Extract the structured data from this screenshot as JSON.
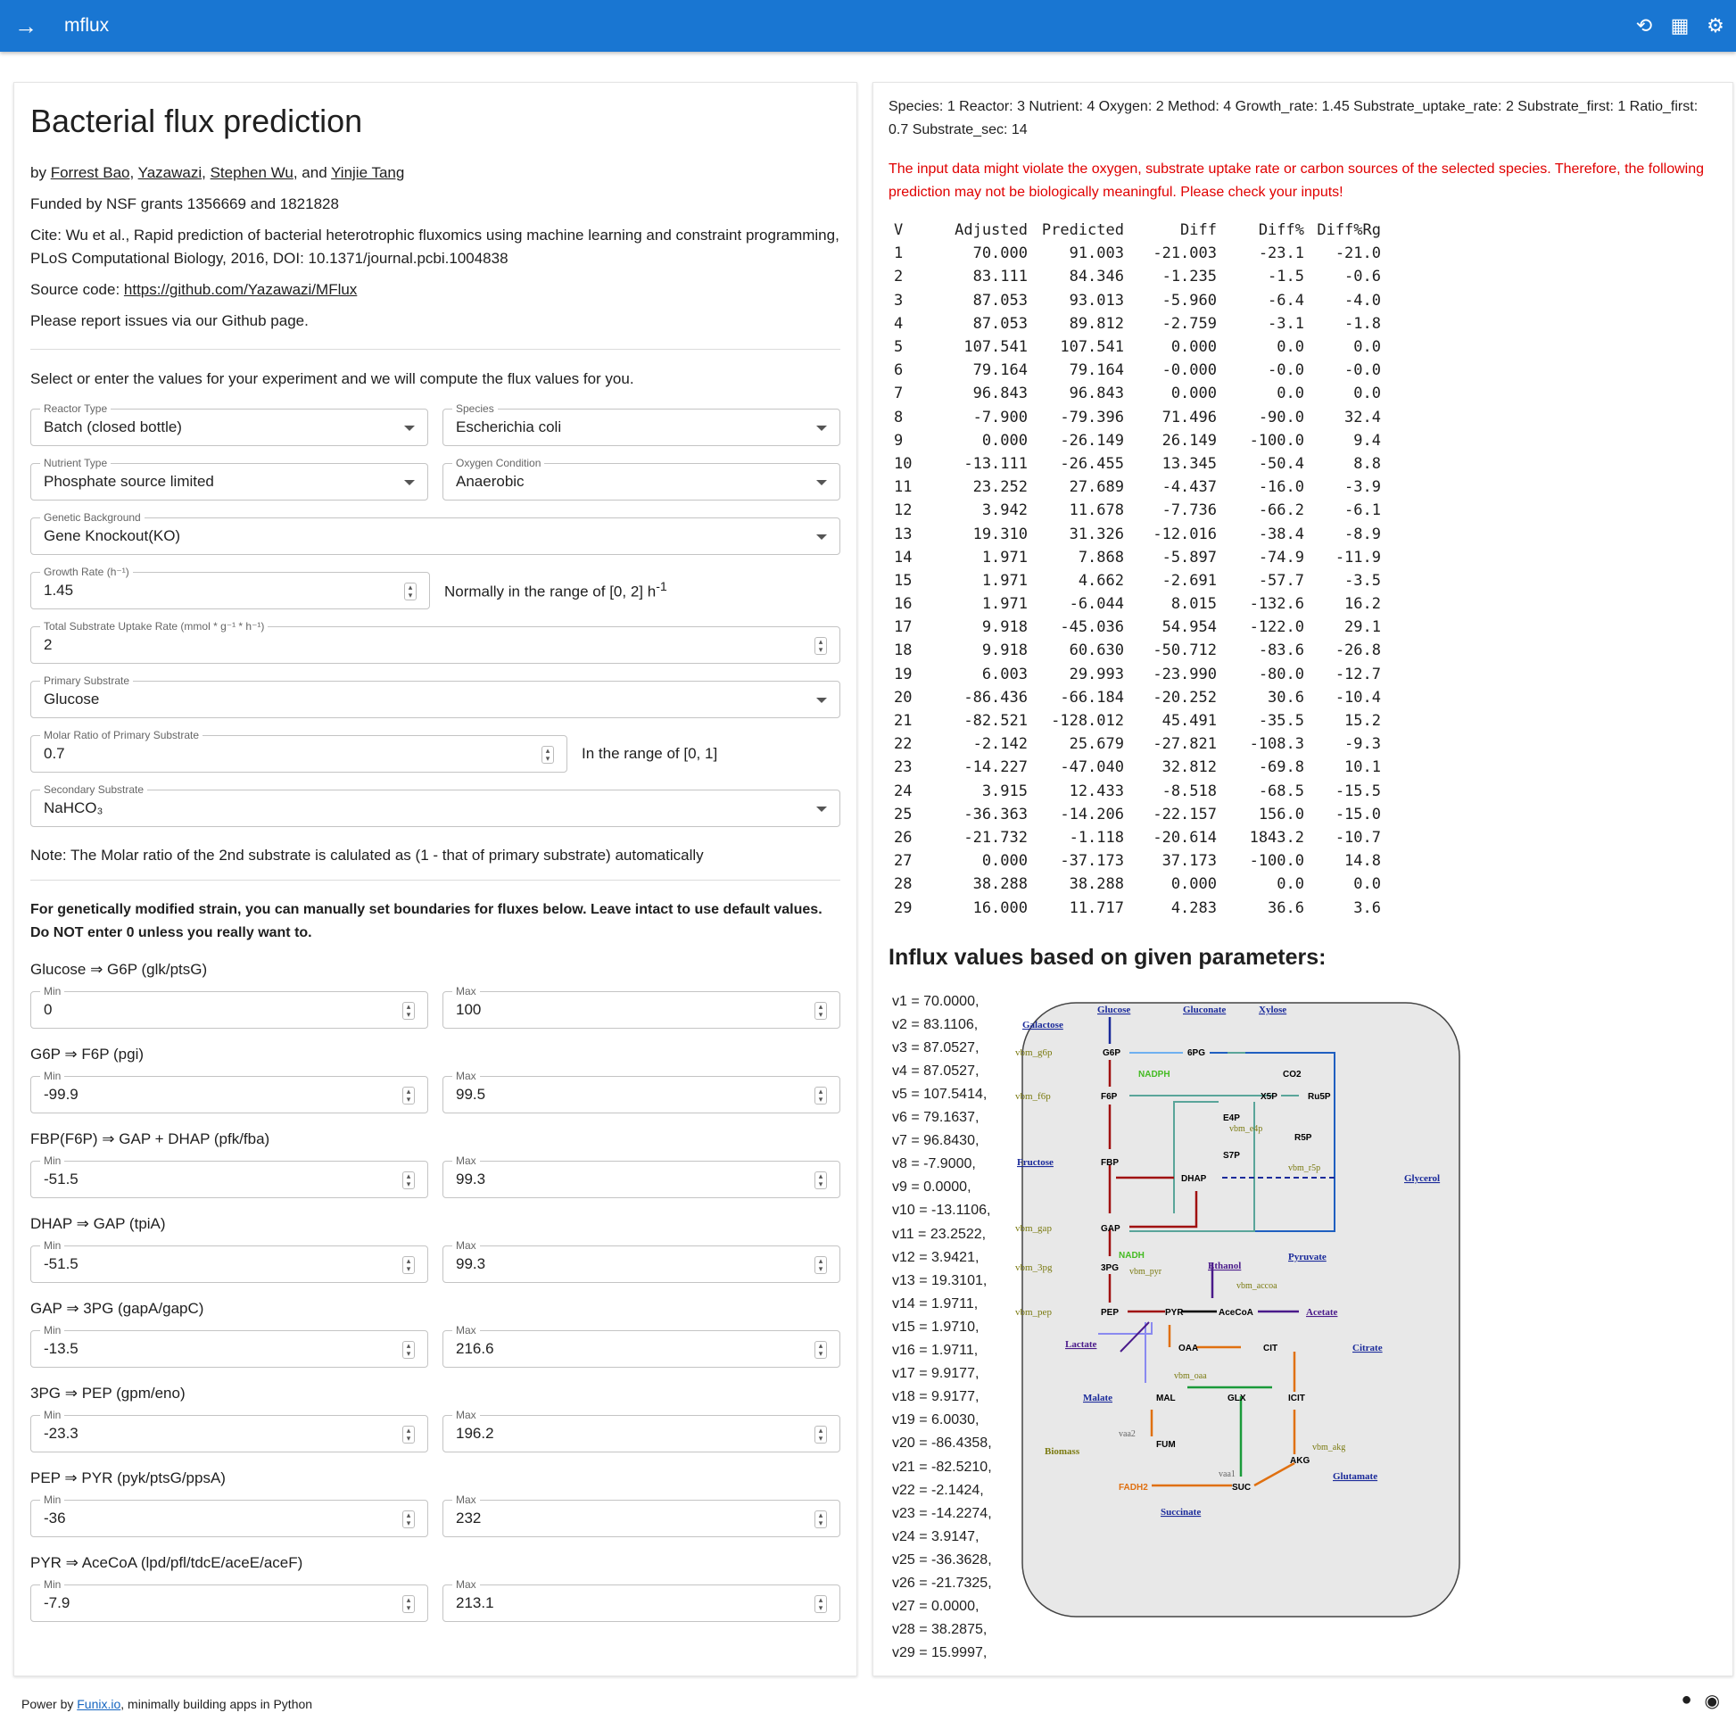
{
  "app": {
    "title": "mflux"
  },
  "header_icons": [
    "arrow-right-icon",
    "history-icon",
    "calendar-icon",
    "gear-icon"
  ],
  "left": {
    "title": "Bacterial flux prediction",
    "by_prefix": "by ",
    "authors": [
      "Forrest Bao",
      "Yazawazi",
      "Stephen Wu",
      "Yinjie Tang"
    ],
    "authors_sep1": ", ",
    "authors_sep2": ", ",
    "authors_sep3": ", and ",
    "funded": "Funded by NSF grants 1356669 and 1821828",
    "cite": "Cite: Wu et al., Rapid prediction of bacterial heterotrophic fluxomics using machine learning and constraint programming, PLoS Computational Biology, 2016, DOI: 10.1371/journal.pcbi.1004838",
    "source_prefix": "Source code: ",
    "source_link": "https://github.com/Yazawazi/MFlux",
    "report": "Please report issues via our Github page.",
    "select_text": "Select or enter the values for your experiment and we will compute the flux values for you.",
    "fields": {
      "reactor": {
        "label": "Reactor Type",
        "value": "Batch (closed bottle)"
      },
      "species": {
        "label": "Species",
        "value": "Escherichia coli"
      },
      "nutrient": {
        "label": "Nutrient Type",
        "value": "Phosphate source limited"
      },
      "oxygen": {
        "label": "Oxygen Condition",
        "value": "Anaerobic"
      },
      "genetic": {
        "label": "Genetic Background",
        "value": "Gene Knockout(KO)"
      },
      "growth": {
        "label": "Growth Rate (h⁻¹)",
        "value": "1.45",
        "note": "Normally in the range of [0, 2] h",
        "note_sup": "-1"
      },
      "uptake": {
        "label": "Total Substrate Uptake Rate (mmol * g⁻¹ * h⁻¹)",
        "value": "2"
      },
      "primary": {
        "label": "Primary Substrate",
        "value": "Glucose"
      },
      "ratio": {
        "label": "Molar Ratio of Primary Substrate",
        "value": "0.7",
        "note": "In the range of [0, 1]"
      },
      "secondary": {
        "label": "Secondary Substrate",
        "value": "NaHCO₃"
      }
    },
    "note2": "Note: The Molar ratio of the 2nd substrate is calulated as (1 - that of primary substrate) automatically",
    "gm_note": "For genetically modified strain, you can manually set boundaries for fluxes below. Leave intact to use default values. Do NOT enter 0 unless you really want to.",
    "min_label": "Min",
    "max_label": "Max",
    "bounds": [
      {
        "name": "Glucose ⇒ G6P (glk/ptsG)",
        "min": "0",
        "max": "100"
      },
      {
        "name": "G6P ⇒ F6P (pgi)",
        "min": "-99.9",
        "max": "99.5"
      },
      {
        "name": "FBP(F6P) ⇒ GAP + DHAP (pfk/fba)",
        "min": "-51.5",
        "max": "99.3"
      },
      {
        "name": "DHAP ⇒ GAP (tpiA)",
        "min": "-51.5",
        "max": "99.3"
      },
      {
        "name": "GAP ⇒ 3PG (gapA/gapC)",
        "min": "-13.5",
        "max": "216.6"
      },
      {
        "name": "3PG ⇒ PEP (gpm/eno)",
        "min": "-23.3",
        "max": "196.2"
      },
      {
        "name": "PEP ⇒ PYR (pyk/ptsG/ppsA)",
        "min": "-36",
        "max": "232"
      },
      {
        "name": "PYR ⇒ AceCoA (lpd/pfl/tdcE/aceE/aceF)",
        "min": "-7.9",
        "max": "213.1"
      }
    ]
  },
  "right": {
    "status": "Species: 1 Reactor: 3 Nutrient: 4 Oxygen: 2 Method: 4 Growth_rate: 1.45 Substrate_uptake_rate: 2 Substrate_first: 1 Ratio_first: 0.7 Substrate_sec: 14",
    "warning": "The input data might violate the oxygen, substrate uptake rate or carbon sources of the selected species. Therefore, the following prediction may not be biologically meaningful. Please check your inputs!",
    "table_headers": [
      "V",
      "Adjusted",
      "Predicted",
      "Diff",
      "Diff%",
      "Diff%Rg"
    ],
    "table_rows": [
      [
        "1",
        "70.000",
        "91.003",
        "-21.003",
        "-23.1",
        "-21.0"
      ],
      [
        "2",
        "83.111",
        "84.346",
        "-1.235",
        "-1.5",
        "-0.6"
      ],
      [
        "3",
        "87.053",
        "93.013",
        "-5.960",
        "-6.4",
        "-4.0"
      ],
      [
        "4",
        "87.053",
        "89.812",
        "-2.759",
        "-3.1",
        "-1.8"
      ],
      [
        "5",
        "107.541",
        "107.541",
        "0.000",
        "0.0",
        "0.0"
      ],
      [
        "6",
        "79.164",
        "79.164",
        "-0.000",
        "-0.0",
        "-0.0"
      ],
      [
        "7",
        "96.843",
        "96.843",
        "0.000",
        "0.0",
        "0.0"
      ],
      [
        "8",
        "-7.900",
        "-79.396",
        "71.496",
        "-90.0",
        "32.4"
      ],
      [
        "9",
        "0.000",
        "-26.149",
        "26.149",
        "-100.0",
        "9.4"
      ],
      [
        "10",
        "-13.111",
        "-26.455",
        "13.345",
        "-50.4",
        "8.8"
      ],
      [
        "11",
        "23.252",
        "27.689",
        "-4.437",
        "-16.0",
        "-3.9"
      ],
      [
        "12",
        "3.942",
        "11.678",
        "-7.736",
        "-66.2",
        "-6.1"
      ],
      [
        "13",
        "19.310",
        "31.326",
        "-12.016",
        "-38.4",
        "-8.9"
      ],
      [
        "14",
        "1.971",
        "7.868",
        "-5.897",
        "-74.9",
        "-11.9"
      ],
      [
        "15",
        "1.971",
        "4.662",
        "-2.691",
        "-57.7",
        "-3.5"
      ],
      [
        "16",
        "1.971",
        "-6.044",
        "8.015",
        "-132.6",
        "16.2"
      ],
      [
        "17",
        "9.918",
        "-45.036",
        "54.954",
        "-122.0",
        "29.1"
      ],
      [
        "18",
        "9.918",
        "60.630",
        "-50.712",
        "-83.6",
        "-26.8"
      ],
      [
        "19",
        "6.003",
        "29.993",
        "-23.990",
        "-80.0",
        "-12.7"
      ],
      [
        "20",
        "-86.436",
        "-66.184",
        "-20.252",
        "30.6",
        "-10.4"
      ],
      [
        "21",
        "-82.521",
        "-128.012",
        "45.491",
        "-35.5",
        "15.2"
      ],
      [
        "22",
        "-2.142",
        "25.679",
        "-27.821",
        "-108.3",
        "-9.3"
      ],
      [
        "23",
        "-14.227",
        "-47.040",
        "32.812",
        "-69.8",
        "10.1"
      ],
      [
        "24",
        "3.915",
        "12.433",
        "-8.518",
        "-68.5",
        "-15.5"
      ],
      [
        "25",
        "-36.363",
        "-14.206",
        "-22.157",
        "156.0",
        "-15.0"
      ],
      [
        "26",
        "-21.732",
        "-1.118",
        "-20.614",
        "1843.2",
        "-10.7"
      ],
      [
        "27",
        "0.000",
        "-37.173",
        "37.173",
        "-100.0",
        "14.8"
      ],
      [
        "28",
        "38.288",
        "38.288",
        "0.000",
        "0.0",
        "0.0"
      ],
      [
        "29",
        "16.000",
        "11.717",
        "4.283",
        "36.6",
        "3.6"
      ]
    ],
    "influx_title": "Influx values based on given parameters:",
    "influx_values": [
      "v1 = 70.0000,",
      "v2 = 83.1106,",
      "v3 = 87.0527,",
      "v4 = 87.0527,",
      "v5 = 107.5414,",
      "v6 = 79.1637,",
      "v7 = 96.8430,",
      "v8 = -7.9000,",
      "v9 = 0.0000,",
      "v10 = -13.1106,",
      "v11 = 23.2522,",
      "v12 = 3.9421,",
      "v13 = 19.3101,",
      "v14 = 1.9711,",
      "v15 = 1.9710,",
      "v16 = 1.9711,",
      "v17 = 9.9177,",
      "v18 = 9.9177,",
      "v19 = 6.0030,",
      "v20 = -86.4358,",
      "v21 = -82.5210,",
      "v22 = -2.1424,",
      "v23 = -14.2274,",
      "v24 = 3.9147,",
      "v25 = -36.3628,",
      "v26 = -21.7325,",
      "v27 = 0.0000,",
      "v28 = 38.2875,",
      "v29 = 15.9997,"
    ],
    "diagram": {
      "metabolites": [
        "Glucose",
        "Gluconate",
        "Xylose",
        "Galactose",
        "G6P",
        "6PG",
        "vbm_g6p",
        "NADPH",
        "CO2",
        "X5P",
        "Ru5P",
        "F6P",
        "vbm_f6p",
        "E4P",
        "vbm_e4p",
        "R5P",
        "S7P",
        "vbm_r5p",
        "Fructose",
        "FBP",
        "DHAP",
        "Glycerol",
        "GAP",
        "vbm_gap",
        "3PG",
        "vbm_3pg",
        "NADH",
        "vbm_pyr",
        "Ethanol",
        "Pyruvate",
        "vbm_accoa",
        "PEP",
        "vbm_pep",
        "PYR",
        "AceCoA",
        "Acetate",
        "Lactate",
        "OAA",
        "CIT",
        "Citrate",
        "vbm_oaa",
        "Malate",
        "MAL",
        "GLX",
        "ICIT",
        "vaa2",
        "FUM",
        "Biomass",
        "AKG",
        "vbm_akg",
        "Glutamate",
        "vaa1",
        "SUC",
        "FADH2",
        "Succinate"
      ],
      "colors": {
        "glycolysis": "#a01010",
        "ppp": "#5aa59a",
        "tca": "#e07010",
        "dashed": "#1a2a9a",
        "nadph": "#44bb22",
        "green": "#1a9a3a",
        "purple": "#4a1a8a",
        "light_purple": "#8a8af0"
      }
    }
  },
  "footer": {
    "prefix": "Power by ",
    "link": "Funix.io",
    "suffix": ", minimally building apps in Python"
  }
}
